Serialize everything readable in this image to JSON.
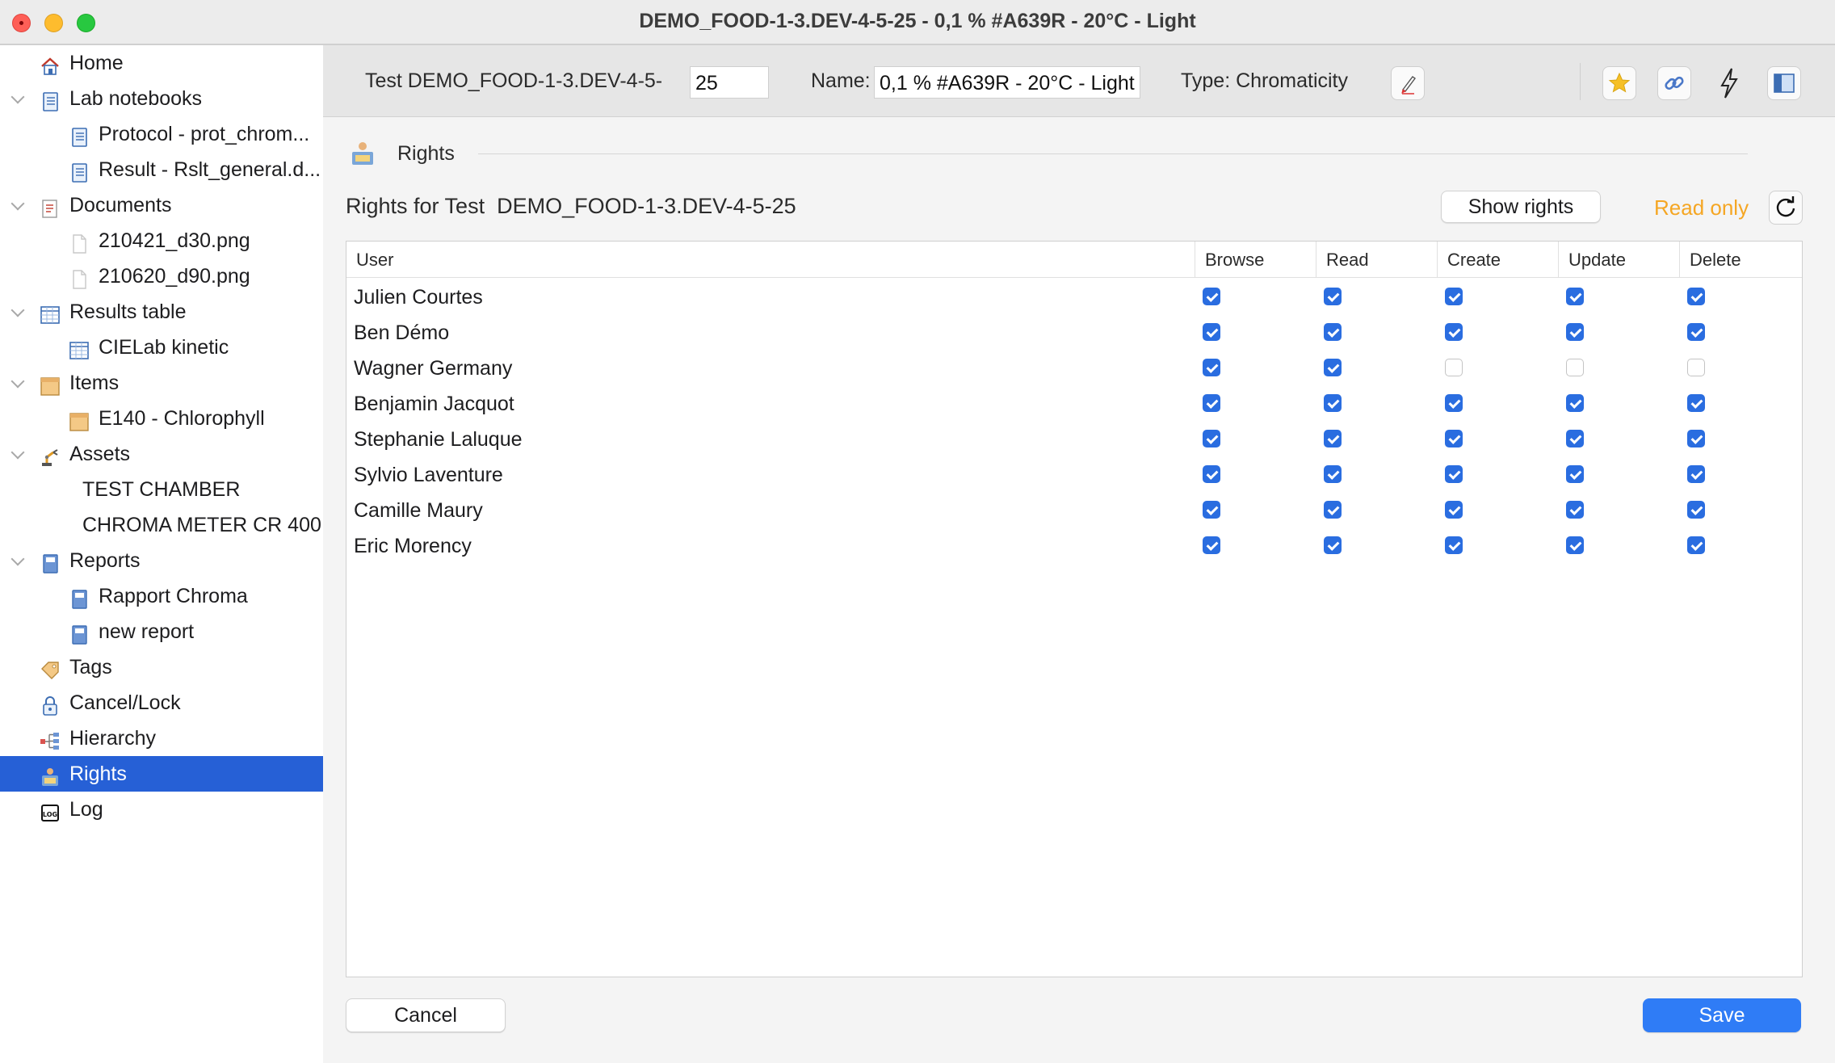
{
  "window": {
    "title": "DEMO_FOOD-1-3.DEV-4-5-25 - 0,1 % #A639R - 20°C - Light"
  },
  "sidebar": {
    "items": [
      {
        "label": "Home",
        "icon": "home-icon",
        "level": 0,
        "expandable": false
      },
      {
        "label": "Lab notebooks",
        "icon": "notebook-icon",
        "level": 0,
        "expandable": true
      },
      {
        "label": "Protocol - prot_chrom...",
        "icon": "notebook-page-icon",
        "level": 1,
        "expandable": false
      },
      {
        "label": "Result - Rslt_general.d...",
        "icon": "notebook-page-icon",
        "level": 1,
        "expandable": false
      },
      {
        "label": "Documents",
        "icon": "documents-icon",
        "level": 0,
        "expandable": true
      },
      {
        "label": "210421_d30.png",
        "icon": "file-icon",
        "level": 1,
        "expandable": false
      },
      {
        "label": "210620_d90.png",
        "icon": "file-icon",
        "level": 1,
        "expandable": false
      },
      {
        "label": "Results table",
        "icon": "table-icon",
        "level": 0,
        "expandable": true
      },
      {
        "label": "CIELab kinetic",
        "icon": "table-icon",
        "level": 1,
        "expandable": false
      },
      {
        "label": "Items",
        "icon": "box-icon",
        "level": 0,
        "expandable": true
      },
      {
        "label": "E140 - Chlorophyll",
        "icon": "box-icon",
        "level": 1,
        "expandable": false
      },
      {
        "label": "Assets",
        "icon": "robot-arm-icon",
        "level": 0,
        "expandable": true
      },
      {
        "label": "TEST CHAMBER",
        "icon": "",
        "level": 2,
        "expandable": false
      },
      {
        "label": "CHROMA METER CR 400",
        "icon": "",
        "level": 2,
        "expandable": false
      },
      {
        "label": "Reports",
        "icon": "report-icon",
        "level": 0,
        "expandable": true
      },
      {
        "label": "Rapport Chroma",
        "icon": "report-icon",
        "level": 1,
        "expandable": false
      },
      {
        "label": "new report",
        "icon": "report-icon",
        "level": 1,
        "expandable": false
      },
      {
        "label": "Tags",
        "icon": "tag-icon",
        "level": 0,
        "expandable": false
      },
      {
        "label": "Cancel/Lock",
        "icon": "lock-icon",
        "level": 0,
        "expandable": false
      },
      {
        "label": "Hierarchy",
        "icon": "hierarchy-icon",
        "level": 0,
        "expandable": false
      },
      {
        "label": "Rights",
        "icon": "rights-icon",
        "level": 0,
        "expandable": false,
        "selected": true
      },
      {
        "label": "Log",
        "icon": "log-icon",
        "level": 0,
        "expandable": false
      }
    ]
  },
  "toolbar": {
    "test_prefix": "Test DEMO_FOOD-1-3.DEV-4-5-",
    "test_number_value": "25",
    "name_label": "Name:",
    "name_value": "0,1 % #A639R - 20°C - Light",
    "type_label": "Type: Chromaticity",
    "buttons": [
      "edit-pencil-icon",
      "favorite-star-icon",
      "link-icon",
      "lightning-icon",
      "panel-layout-icon"
    ]
  },
  "section": {
    "title": "Rights",
    "rights_for_label": "Rights for Test",
    "rights_for_value": "DEMO_FOOD-1-3.DEV-4-5-25",
    "show_rights_label": "Show rights",
    "read_only_label": "Read only"
  },
  "table": {
    "columns": [
      "User",
      "Browse",
      "Read",
      "Create",
      "Update",
      "Delete"
    ],
    "rows": [
      {
        "user": "Julien Courtes",
        "rights": [
          true,
          true,
          true,
          true,
          true
        ]
      },
      {
        "user": "Ben Démo",
        "rights": [
          true,
          true,
          true,
          true,
          true
        ]
      },
      {
        "user": "Wagner Germany",
        "rights": [
          true,
          true,
          false,
          false,
          false
        ]
      },
      {
        "user": "Benjamin Jacquot",
        "rights": [
          true,
          true,
          true,
          true,
          true
        ]
      },
      {
        "user": "Stephanie Laluque",
        "rights": [
          true,
          true,
          true,
          true,
          true
        ]
      },
      {
        "user": "Sylvio Laventure",
        "rights": [
          true,
          true,
          true,
          true,
          true
        ]
      },
      {
        "user": "Camille Maury",
        "rights": [
          true,
          true,
          true,
          true,
          true
        ]
      },
      {
        "user": "Eric Morency",
        "rights": [
          true,
          true,
          true,
          true,
          true
        ]
      }
    ]
  },
  "footer": {
    "cancel_label": "Cancel",
    "save_label": "Save"
  },
  "colors": {
    "selection": "#2660d6",
    "checkbox_checked": "#2a6de0",
    "read_only": "#f5a623",
    "save_button": "#2f7cf6"
  }
}
